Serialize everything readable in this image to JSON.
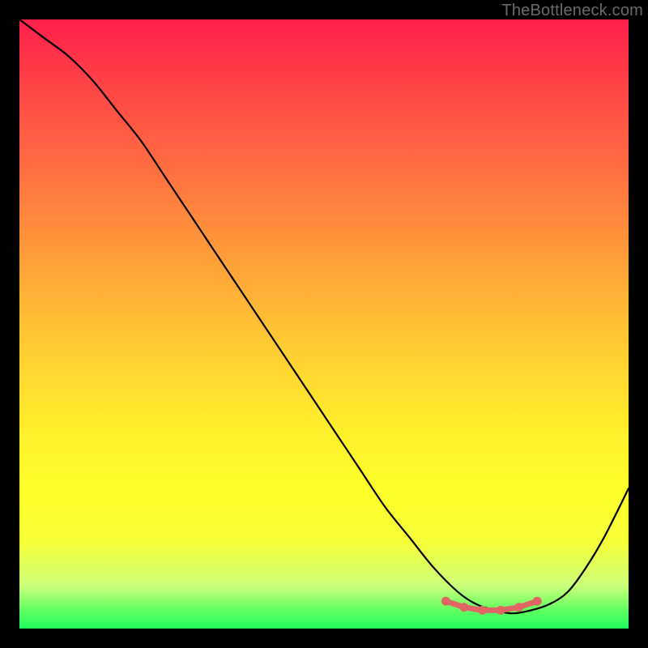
{
  "watermark": "TheBottleneck.com",
  "chart_data": {
    "type": "line",
    "title": "",
    "xlabel": "",
    "ylabel": "",
    "xlim": [
      0,
      100
    ],
    "ylim": [
      0,
      100
    ],
    "x": [
      0,
      4,
      8,
      12,
      16,
      20,
      24,
      28,
      32,
      36,
      40,
      44,
      48,
      52,
      56,
      60,
      64,
      68,
      72,
      75,
      78,
      81,
      84,
      87,
      90,
      93,
      96,
      100
    ],
    "values": [
      100,
      97,
      94,
      90,
      85,
      80,
      74,
      68,
      62,
      56,
      50,
      44,
      38,
      32,
      26,
      20,
      15,
      10,
      6,
      4,
      3,
      2.5,
      3,
      4,
      6,
      10,
      15,
      23
    ],
    "valley_markers_x": [
      70,
      73,
      76,
      79,
      82,
      85
    ],
    "valley_markers_y": [
      4.5,
      3.5,
      3,
      3,
      3.5,
      4.5
    ],
    "gradient_stops": [
      {
        "pos": 0,
        "color": "#ff1f4a"
      },
      {
        "pos": 50,
        "color": "#ffd028"
      },
      {
        "pos": 100,
        "color": "#20ff60"
      }
    ]
  }
}
